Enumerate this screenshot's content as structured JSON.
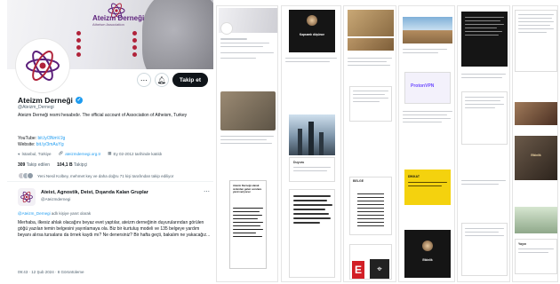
{
  "profile": {
    "banner": {
      "title": "Ateizm Derneği",
      "subtitle": "Atheism Association",
      "items": [
        "",
        "",
        "",
        "",
        "",
        "",
        "",
        ""
      ]
    },
    "display_name": "Ateizm Derneği",
    "handle": "@Ateizm_Dernegi",
    "follow_label": "Takip et",
    "bio": "Ateizm Derneği resmi hesabıdır. The official account of Association of Atheism, Turkey",
    "youtube_label": "YouTube:",
    "youtube_link": "bit.ly/3NmVJg",
    "website_label": "Website:",
    "website_link": "bit.ly/3mAuYg",
    "location": "İstanbul, Türkiye",
    "site": "ateizmdernegi.org.tr",
    "joined": "Ey 02-2012 tarihinde katıldı",
    "following_count": "309",
    "following_label": "Takip edilen",
    "followers_count": "104,1 B",
    "followers_label": "Takipçi",
    "followed_by": "Yeni Nesil Kolbey, mehmet key ve daha doğru 71 kişi tarafından takip ediliyor"
  },
  "tweet": {
    "author": "Ateist, Agnostik, Deist, Dışarıda Kalan Gruplar",
    "handle": "@Ateizmdernegi",
    "reply_to_label": "Yanıt olarak",
    "reply_to": "@Ateizm_Dernegi",
    "reply_suffix": "adlı kişiye yanıt olarak",
    "body": "Merhaba, ilkesiz ahlak olacağını beyaz evet yaptılar, ateizm derneğinin duyurularından görülen göğü yazılan temin belgesini yayınlamaya ola. Biz bir kurtuluş modeli ve 135 belgeye yardım beyanı alırsa tursalans da örnek kaydı mı? Ne denersiniz? Bir hafta geçti, bakalım ne yakacağız...",
    "footer": "09:43 · 12 Şub 2024 · 8 Görüntüleme"
  },
  "collage": {
    "tiles": [
      {
        "caption": "Kapsamlı düşünce"
      },
      {
        "caption": "BELGE"
      },
      {
        "caption": "Ateizm Derneği Açıklaması"
      },
      {
        "caption": "Duyuru"
      },
      {
        "caption": "Etkinlik"
      },
      {
        "caption": "Yayın"
      }
    ],
    "poster_text": "Ateizm Derneği olarak sizlerden gelen sorulara yanıt veriyoruz",
    "ad_brand": "ProtonVPN",
    "yellow_text": "DİKKAT",
    "dark_event_text": "Etkinlik"
  },
  "colors": {
    "accent": "#1d9bf0",
    "brand": "#5b1f7a",
    "banner_dot": "#b0233a",
    "follow_button": "#0f1419"
  }
}
